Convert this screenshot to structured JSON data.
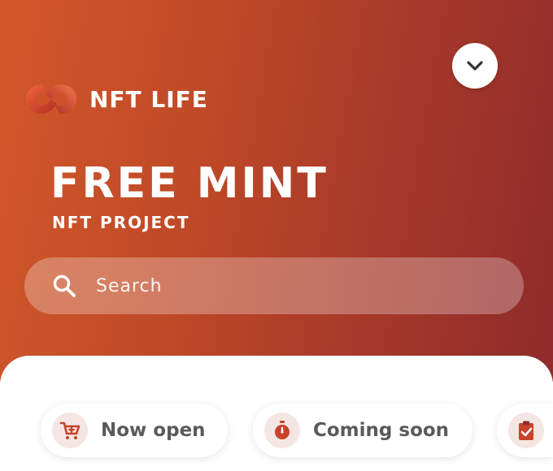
{
  "brand": {
    "logo_text": "NFT LIFE"
  },
  "hero": {
    "title": "FREE MINT",
    "subtitle": "NFT PROJECT"
  },
  "search": {
    "placeholder": "Search"
  },
  "filters": [
    {
      "label": "Now open",
      "icon": "cart-plus-icon"
    },
    {
      "label": "Coming soon",
      "icon": "stopwatch-icon"
    },
    {
      "label": "",
      "icon": "clipboard-check-icon"
    }
  ],
  "colors": {
    "gradient_start": "#d2582a",
    "gradient_end": "#8f2b2b",
    "accent": "#c8432a",
    "chip_text": "#5a5a5a"
  },
  "icons": {
    "dropdown": "chevron-down-icon",
    "search": "search-icon",
    "logo": "infinity-logo-icon"
  }
}
